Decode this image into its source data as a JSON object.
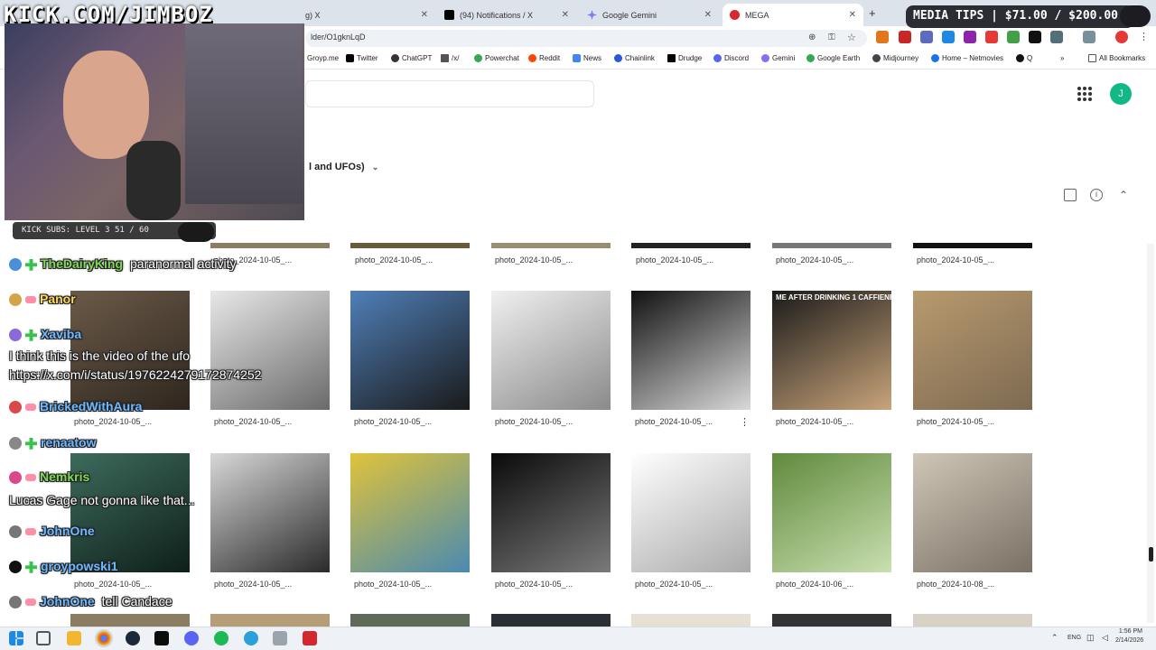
{
  "browser": {
    "tabs": [
      {
        "label": "g) X",
        "icon": "x-icon"
      },
      {
        "label": "(94) Notifications / X",
        "icon": "x-icon"
      },
      {
        "label": "Google Gemini",
        "icon": "gemini-icon"
      },
      {
        "label": "MEGA",
        "icon": "mega-icon"
      }
    ],
    "url": "lder/O1gknLqD",
    "bookmarks": [
      "Groyp.me",
      "Twitter",
      "ChatGPT",
      "/x/",
      "Powerchat",
      "Reddit",
      "News",
      "Chainlink",
      "Drudge",
      "Discord",
      "Gemini",
      "Google Earth",
      "Midjourney",
      "Home – Netmovies",
      "Q"
    ],
    "all_bookmarks": "All Bookmarks"
  },
  "mega": {
    "avatar_letter": "J",
    "folder_title": "l and UFOs)",
    "top_row_captions": [
      "photo_2024-10-05_...",
      "photo_2024-10-05_...",
      "photo_2024-10-05_...",
      "photo_2024-10-05_...",
      "photo_2024-10-05_...",
      "photo_2024-10-05_..."
    ],
    "rows": [
      [
        {
          "caption": "photo_2024-10-05_...",
          "color1": "#6b5a48",
          "color2": "#2e261e"
        },
        {
          "caption": "photo_2024-10-05_...",
          "color1": "#e8e8e8",
          "color2": "#6a6a6a"
        },
        {
          "caption": "photo_2024-10-05_...",
          "color1": "#4f7fb8",
          "color2": "#1a1a1a"
        },
        {
          "caption": "photo_2024-10-05_...",
          "color1": "#f0f0f0",
          "color2": "#8a8a8a"
        },
        {
          "caption": "photo_2024-10-05_...",
          "color1": "#111111",
          "color2": "#d9d9d9"
        },
        {
          "caption": "photo_2024-10-05_...",
          "color1": "#1a1a1a",
          "color2": "#c9a47a",
          "overlay": "ME AFTER DRINKING 1 CAFFIENE"
        },
        {
          "caption": "photo_2024-10-05_...",
          "color1": "#b89a6e",
          "color2": "#7d6a52"
        }
      ],
      [
        {
          "caption": "photo_2024-10-05_...",
          "color1": "#3d6b5c",
          "color2": "#0e1f1a"
        },
        {
          "caption": "photo_2024-10-05_...",
          "color1": "#d8d8d8",
          "color2": "#2a2a2a"
        },
        {
          "caption": "photo_2024-10-05_...",
          "color1": "#e0c33a",
          "color2": "#4a8ab0"
        },
        {
          "caption": "photo_2024-10-05_...",
          "color1": "#0a0a0a",
          "color2": "#7a7a7a"
        },
        {
          "caption": "photo_2024-10-05_...",
          "color1": "#ffffff",
          "color2": "#aaaaaa"
        },
        {
          "caption": "photo_2024-10-06_...",
          "color1": "#5f8a3c",
          "color2": "#c9dfb0"
        },
        {
          "caption": "photo_2024-10-08_...",
          "color1": "#cfc6b6",
          "color2": "#7a7166"
        }
      ]
    ]
  },
  "stream": {
    "watermark": "KICK.COM/JIMBOZ",
    "media_tips": "MEDIA TIPS | $71.00 / $200.00",
    "kick_subs": "KICK SUBS: LEVEL 3 51 / 60",
    "chat": [
      {
        "user": "TheDairyKing",
        "msg": "paranormal activity",
        "color": "u"
      },
      {
        "user": "Panor",
        "msg": "",
        "color": "uy"
      },
      {
        "user": "Xaviba",
        "msg": "",
        "color": "ub"
      },
      {
        "user": "",
        "msg": "I think this is the video of the ufo",
        "color": "u"
      },
      {
        "user": "",
        "msg": "https://x.com/i/status/1976224279172874252",
        "color": "u"
      },
      {
        "user": "BrickedWithAura",
        "msg": "",
        "color": "ub"
      },
      {
        "user": "renaatow",
        "msg": "",
        "color": "ub"
      },
      {
        "user": "Nemkris",
        "msg": "",
        "color": "u"
      },
      {
        "user": "",
        "msg": "Lucas Gage not gonna like that...",
        "color": "u"
      },
      {
        "user": "JohnOne",
        "msg": "",
        "color": "ub"
      },
      {
        "user": "groypowski1",
        "msg": "",
        "color": "ub"
      },
      {
        "user": "JohnOne",
        "msg": "tell Candace",
        "color": "ub"
      }
    ]
  },
  "taskbar": {
    "lang": "ENG",
    "time": "1:56 PM",
    "date": "2/14/2026"
  }
}
